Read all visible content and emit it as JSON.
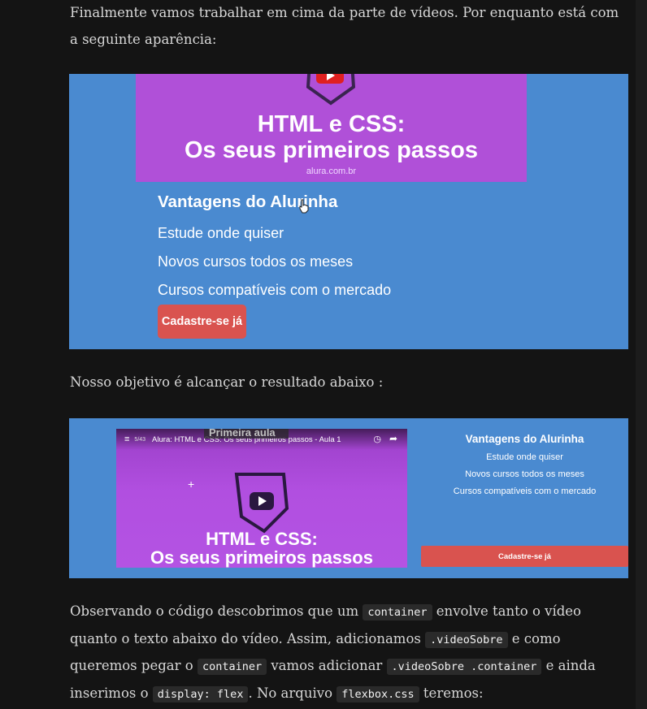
{
  "para1": "Finalmente vamos trabalhar em cima da parte de vídeos. Por enquanto está com a seguinte aparência:",
  "image1": {
    "thumb_title_line1": "HTML e CSS:",
    "thumb_title_line2": "Os seus primeiros passos",
    "thumb_site": "alura.com.br",
    "heading": "Vantagens do Alurinha",
    "items": [
      "Estude onde quiser",
      "Novos cursos todos os meses",
      "Cursos compatíveis com o mercado"
    ],
    "button": "Cadastre-se já"
  },
  "para2": "Nosso objetivo é alcançar o resultado abaixo :",
  "image2": {
    "player": {
      "playlist_count": "5/43",
      "video_title": "Alura: HTML e CSS: Os seus primeiros passos - Aula 1",
      "overlay_text": "Primeira aula",
      "title_line1": "HTML e CSS:",
      "title_line2": "Os seus primeiros passos"
    },
    "heading": "Vantagens do Alurinha",
    "items": [
      "Estude onde quiser",
      "Novos cursos todos os meses",
      "Cursos compatíveis com o mercado"
    ],
    "button": "Cadastre-se já"
  },
  "para3": {
    "t1": "Observando o código descobrimos que um",
    "c1": "container",
    "t2": "envolve tanto o vídeo quanto o texto abaixo do vídeo. Assim, adicionamos",
    "c2": ".videoSobre",
    "t3": "e como queremos pegar o",
    "c3": "container",
    "t4": "vamos adicionar",
    "c4": ".videoSobre .container",
    "t5": "e ainda inserimos o",
    "c5": "display: flex",
    "t6": ". No arquivo",
    "c6": "flexbox.css",
    "t7": "teremos:"
  },
  "colors": {
    "page_bg": "#141414",
    "image_bg": "#4a8ad0",
    "thumb_purple": "#b050d8",
    "button_red": "#d9534f",
    "youtube_red": "#e02020"
  }
}
